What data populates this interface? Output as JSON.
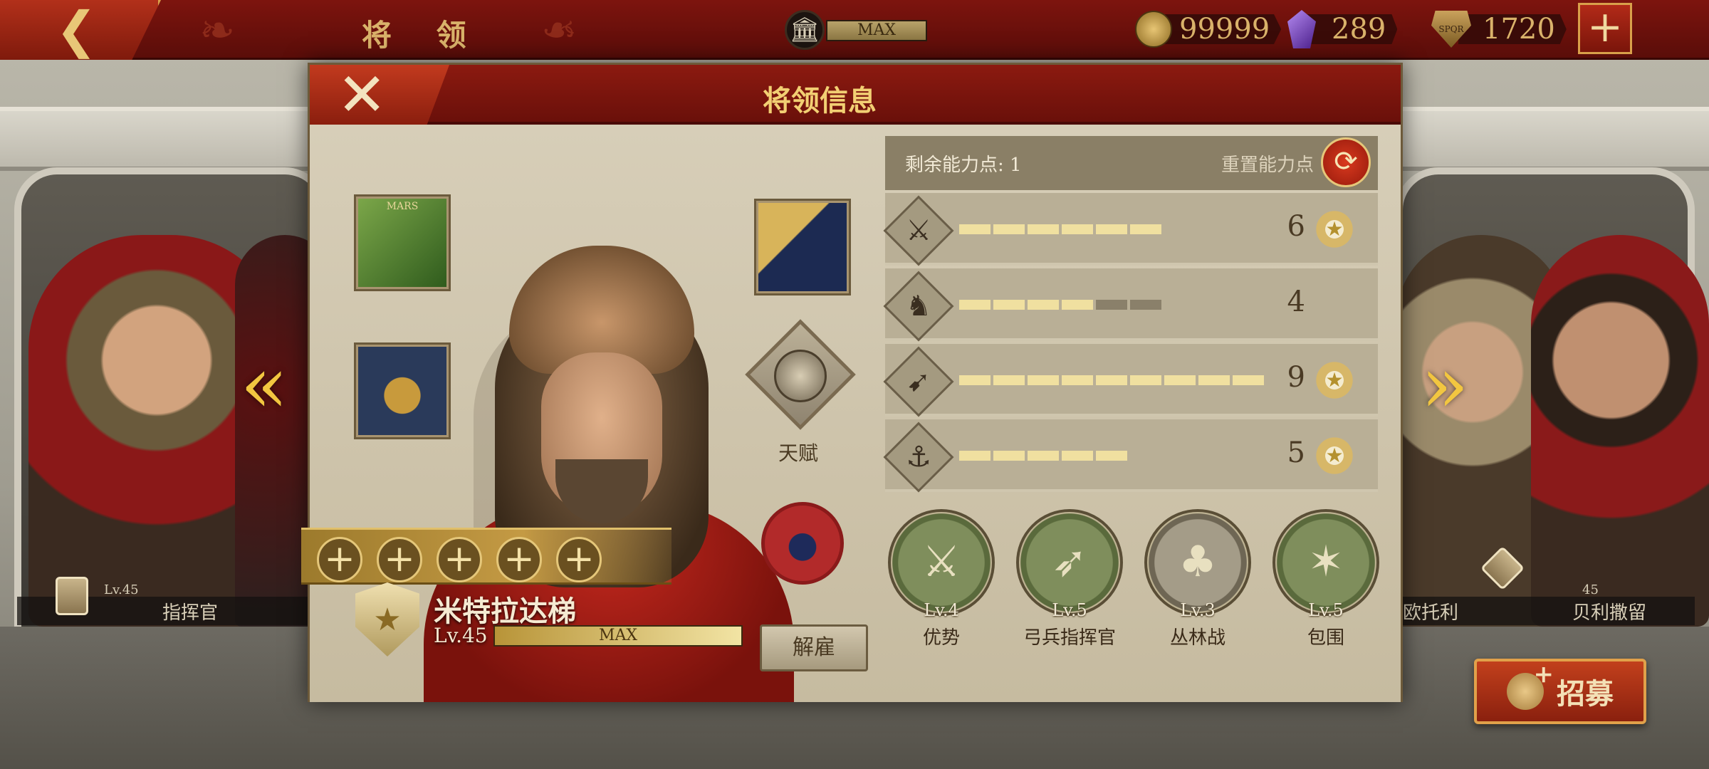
{
  "topbar": {
    "title": "将 领",
    "max_label": "MAX",
    "gold": "99999",
    "gems": "289",
    "spqr": "1720",
    "back_icon": "back-arrow-icon",
    "add_icon": "plus-icon"
  },
  "background": {
    "left_hero": {
      "level": "Lv.45",
      "name": "指挥官"
    },
    "right_heroes": [
      {
        "name": "欧托利"
      },
      {
        "name": "贝利撒留",
        "level": "45"
      }
    ],
    "recruit_label": "招募"
  },
  "modal": {
    "title": "将领信息",
    "close_icon": "close-icon",
    "equipment": [
      {
        "name": "mars-banner",
        "text": "MARS"
      },
      {
        "name": "golden-helmet"
      },
      {
        "name": "golden-scroll"
      }
    ],
    "talent_label": "天赋",
    "plus_slots": [
      "+",
      "+",
      "+",
      "+",
      "+"
    ],
    "hero": {
      "name": "米特拉达梯",
      "level": "Lv.45",
      "exp_label": "MAX",
      "exp_fraction": 1.0
    },
    "dismiss_label": "解雇",
    "stats_header": {
      "remaining_points": "剩余能力点: 1",
      "reset_label": "重置能力点"
    },
    "stats": [
      {
        "name": "sword",
        "glyph": "⚔",
        "value": "6",
        "filled": 6,
        "total": 6,
        "medal": true
      },
      {
        "name": "cavalry",
        "glyph": "♞",
        "value": "4",
        "filled": 4,
        "total": 6,
        "medal": false
      },
      {
        "name": "archery",
        "glyph": "➹",
        "value": "9",
        "filled": 9,
        "total": 9,
        "medal": true
      },
      {
        "name": "navy",
        "glyph": "⚓",
        "value": "5",
        "filled": 5,
        "total": 5,
        "medal": true
      }
    ],
    "skills": [
      {
        "level": "Lv.4",
        "name": "优势",
        "glyph": "⚔",
        "style": "green"
      },
      {
        "level": "Lv.5",
        "name": "弓兵指挥官",
        "glyph": "➶",
        "style": "green"
      },
      {
        "level": "Lv.3",
        "name": "丛林战",
        "glyph": "♣",
        "style": "gray"
      },
      {
        "level": "Lv.5",
        "name": "包围",
        "glyph": "✶",
        "style": "green"
      }
    ]
  },
  "colors": {
    "header_red": "#8c1a10",
    "panel_bg": "#c9bea4",
    "bar_on": "#f0e0a0",
    "bar_off": "#8a806a",
    "accent_gold": "#f2cf73"
  }
}
